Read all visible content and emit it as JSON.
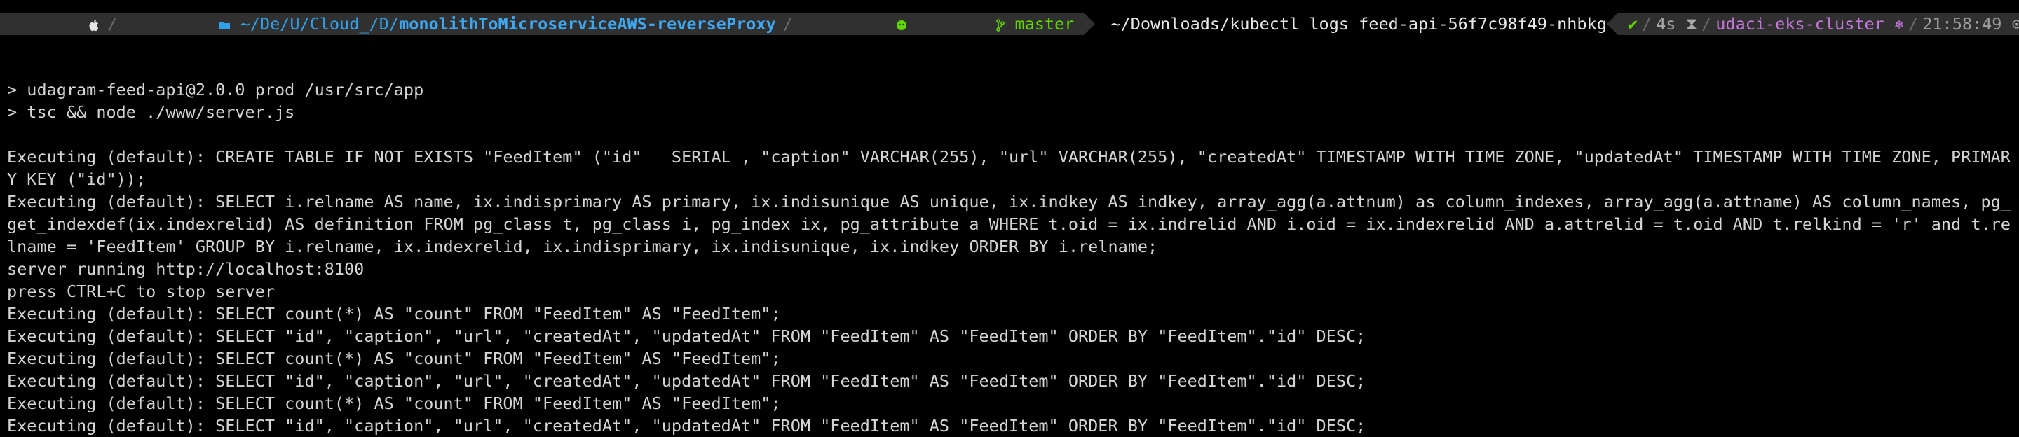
{
  "prompt": {
    "os_icon": "",
    "folder_icon": "folder-icon",
    "path_prefix": "~/De/U/Cloud_/D/",
    "path_anchor": "monolithToMicroserviceAWS-reverseProxy",
    "vcs_icon": "git-branch-icon",
    "branch": "master",
    "command": "~/Downloads/kubectl logs feed-api-56f7c98f49-nhbkg",
    "status_ok": "✔",
    "duration": "4s ⧗",
    "context": "udaci-eks-cluster ⎈",
    "time": "21:58:49 ⊙"
  },
  "log_lines": [
    "",
    "> udagram-feed-api@2.0.0 prod /usr/src/app",
    "> tsc && node ./www/server.js",
    "",
    "Executing (default): CREATE TABLE IF NOT EXISTS \"FeedItem\" (\"id\"   SERIAL , \"caption\" VARCHAR(255), \"url\" VARCHAR(255), \"createdAt\" TIMESTAMP WITH TIME ZONE, \"updatedAt\" TIMESTAMP WITH TIME ZONE, PRIMARY KEY (\"id\"));",
    "Executing (default): SELECT i.relname AS name, ix.indisprimary AS primary, ix.indisunique AS unique, ix.indkey AS indkey, array_agg(a.attnum) as column_indexes, array_agg(a.attname) AS column_names, pg_get_indexdef(ix.indexrelid) AS definition FROM pg_class t, pg_class i, pg_index ix, pg_attribute a WHERE t.oid = ix.indrelid AND i.oid = ix.indexrelid AND a.attrelid = t.oid AND t.relkind = 'r' and t.relname = 'FeedItem' GROUP BY i.relname, ix.indexrelid, ix.indisprimary, ix.indisunique, ix.indkey ORDER BY i.relname;",
    "server running http://localhost:8100",
    "press CTRL+C to stop server",
    "Executing (default): SELECT count(*) AS \"count\" FROM \"FeedItem\" AS \"FeedItem\";",
    "Executing (default): SELECT \"id\", \"caption\", \"url\", \"createdAt\", \"updatedAt\" FROM \"FeedItem\" AS \"FeedItem\" ORDER BY \"FeedItem\".\"id\" DESC;",
    "Executing (default): SELECT count(*) AS \"count\" FROM \"FeedItem\" AS \"FeedItem\";",
    "Executing (default): SELECT \"id\", \"caption\", \"url\", \"createdAt\", \"updatedAt\" FROM \"FeedItem\" AS \"FeedItem\" ORDER BY \"FeedItem\".\"id\" DESC;",
    "Executing (default): SELECT count(*) AS \"count\" FROM \"FeedItem\" AS \"FeedItem\";",
    "Executing (default): SELECT \"id\", \"caption\", \"url\", \"createdAt\", \"updatedAt\" FROM \"FeedItem\" AS \"FeedItem\" ORDER BY \"FeedItem\".\"id\" DESC;"
  ],
  "colors": {
    "background": "#000000",
    "segment": "#303030",
    "path": "#32a0e8",
    "branch": "#5fd700",
    "context": "#c678dd"
  }
}
